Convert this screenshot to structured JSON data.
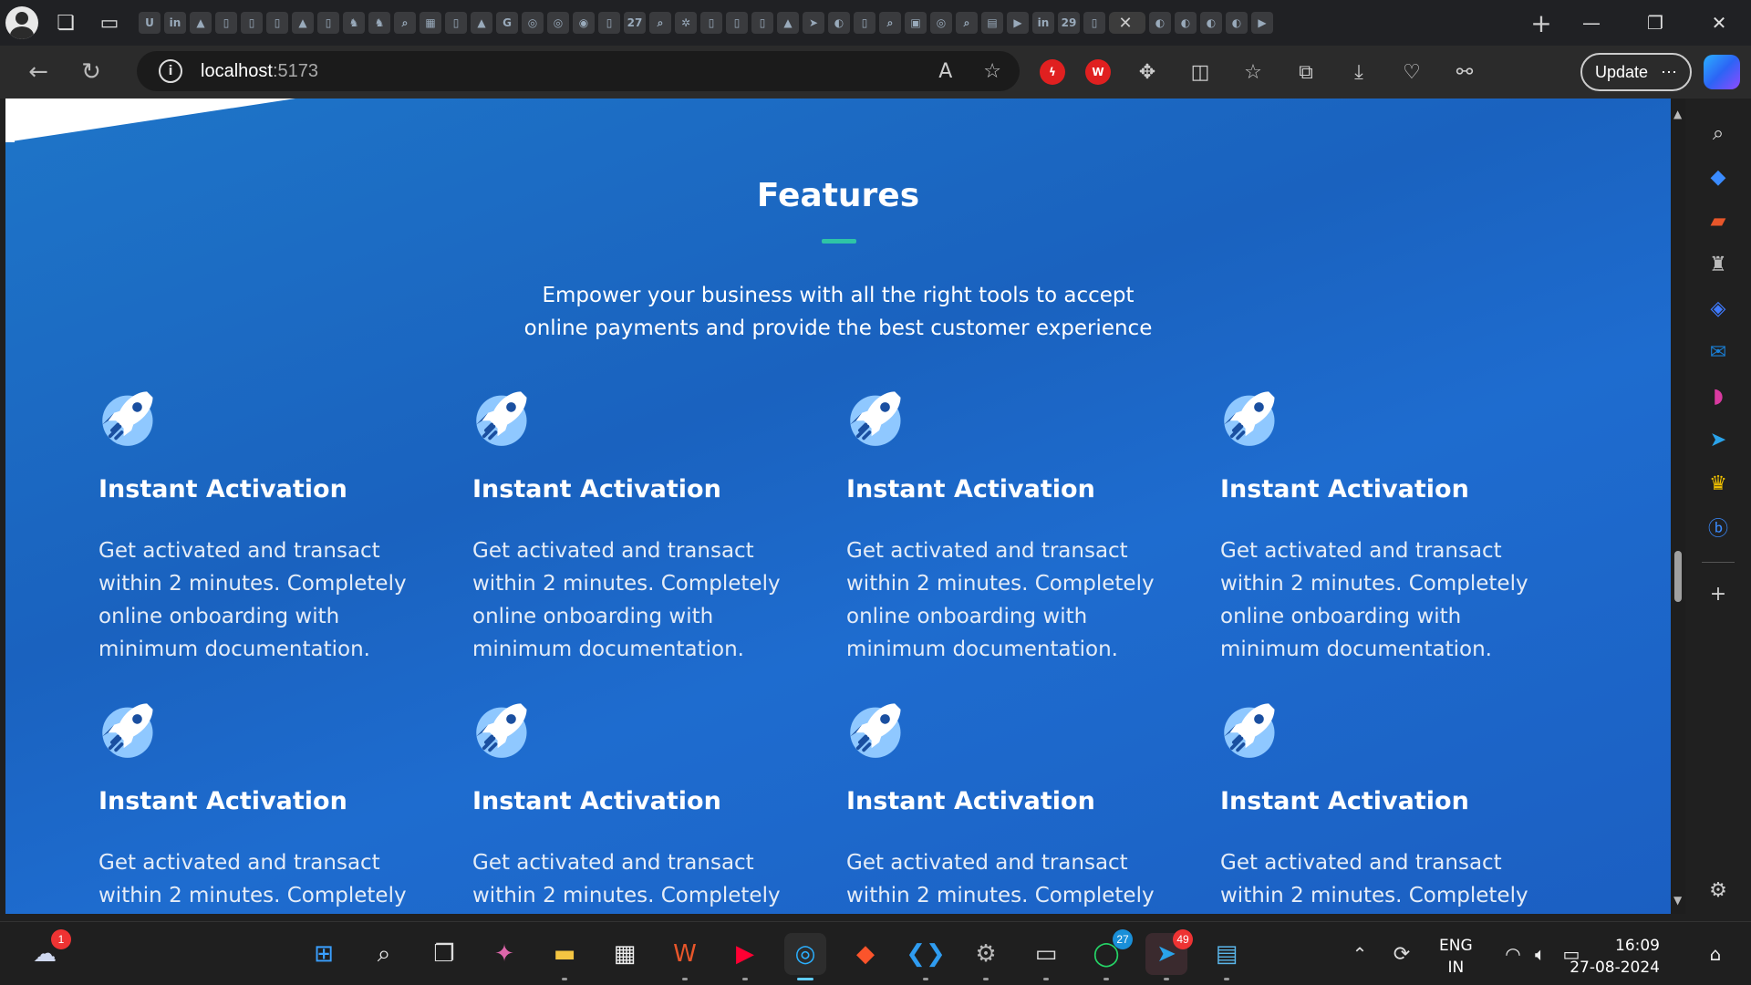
{
  "browser": {
    "tab_close_glyph": "✕",
    "new_tab_glyph": "+",
    "window_controls": {
      "minimize": "—",
      "restore": "❐",
      "close": "✕"
    },
    "address": {
      "host": "localhost",
      "port": ":5173"
    },
    "read_aloud_label": "A",
    "update_label": "Update",
    "more_glyph": "⋯",
    "ext_wn_label": "W",
    "tabs": [
      "U",
      "in",
      "▲",
      "▯",
      "▯",
      "▯",
      "▲",
      "▯",
      "♞",
      "♞",
      "⌕",
      "▦",
      "▯",
      "▲",
      "G",
      "◎",
      "◎",
      "◉",
      "▯",
      "27",
      "⌕",
      "✲",
      "▯",
      "▯",
      "▯",
      "▲",
      "➤",
      "◐",
      "▯",
      "⌕",
      "▣",
      "◎",
      "⌕",
      "▤",
      "▶",
      "in",
      "29",
      "▯"
    ],
    "tabs_after_active": [
      "◐",
      "◐",
      "◐",
      "◐",
      "▶"
    ]
  },
  "page": {
    "title": "Features",
    "subtitle_line1": "Empower your business with all the right tools to accept",
    "subtitle_line2": "online payments and provide the best customer experience",
    "features": [
      {
        "title": "Instant Activation",
        "desc": "Get activated and transact within 2 minutes. Completely online onboarding with minimum documentation."
      },
      {
        "title": "Instant Activation",
        "desc": "Get activated and transact within 2 minutes. Completely online onboarding with minimum documentation."
      },
      {
        "title": "Instant Activation",
        "desc": "Get activated and transact within 2 minutes. Completely online onboarding with minimum documentation."
      },
      {
        "title": "Instant Activation",
        "desc": "Get activated and transact within 2 minutes. Completely online onboarding with minimum documentation."
      },
      {
        "title": "Instant Activation",
        "desc": "Get activated and transact within 2 minutes. Completely"
      },
      {
        "title": "Instant Activation",
        "desc": "Get activated and transact within 2 minutes. Completely"
      },
      {
        "title": "Instant Activation",
        "desc": "Get activated and transact within 2 minutes. Completely"
      },
      {
        "title": "Instant Activation",
        "desc": "Get activated and transact within 2 minutes. Completely"
      }
    ],
    "colors": {
      "accent_bar": "#2ec4a6",
      "background": "#1e6ccf"
    }
  },
  "taskbar": {
    "weather_badge": "1",
    "whatsapp_badge": "27",
    "telegram_badge": "49",
    "lang_line1": "ENG",
    "lang_line2": "IN",
    "time": "16:09",
    "date": "27-08-2024"
  }
}
